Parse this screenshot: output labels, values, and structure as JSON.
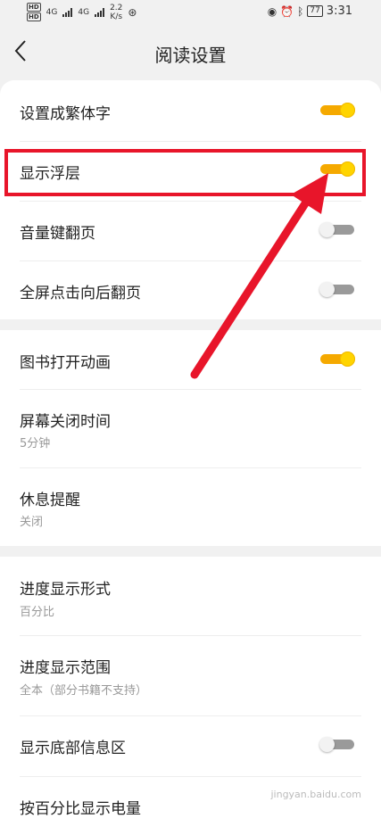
{
  "status_bar": {
    "hd_1": "HD",
    "hd_2": "HD",
    "net_1": "4G",
    "net_2": "4G",
    "speed_value": "2.2",
    "speed_unit": "K/s",
    "battery": "77",
    "time": "3:31"
  },
  "header": {
    "title": "阅读设置"
  },
  "group1": [
    {
      "label": "设置成繁体字",
      "toggle": "on"
    },
    {
      "label": "显示浮层",
      "toggle": "on"
    },
    {
      "label": "音量键翻页",
      "toggle": "off"
    },
    {
      "label": "全屏点击向后翻页",
      "toggle": "off"
    }
  ],
  "group2": {
    "book_open_animation": {
      "label": "图书打开动画",
      "toggle": "on"
    },
    "screen_off_time": {
      "label": "屏幕关闭时间",
      "value": "5分钟"
    },
    "rest_reminder": {
      "label": "休息提醒",
      "value": "关闭"
    }
  },
  "group3": {
    "progress_format": {
      "label": "进度显示形式",
      "value": "百分比"
    },
    "progress_range": {
      "label": "进度显示范围",
      "value": "全本（部分书籍不支持）"
    },
    "bottom_info": {
      "label": "显示底部信息区",
      "toggle": "off"
    },
    "battery_percent": {
      "label": "按百分比显示电量"
    }
  },
  "watermark": {
    "text": "jingyan.baidu.com"
  },
  "colors": {
    "toggle_on_track": "#f5a900",
    "toggle_on_knob": "#ffd400",
    "toggle_off_track": "#9a9a9a",
    "annotation_red": "#e8152a"
  }
}
